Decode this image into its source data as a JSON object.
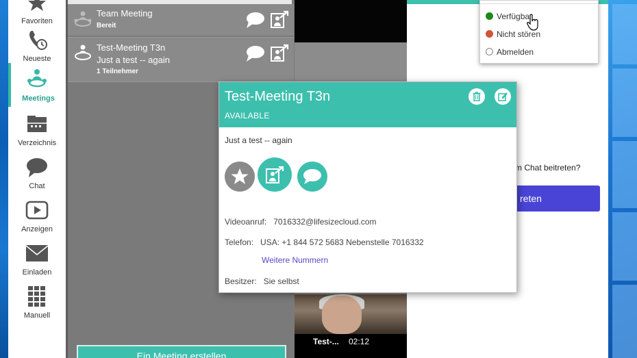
{
  "nav": {
    "items": [
      {
        "label": "Favoriten",
        "icon": "star-icon"
      },
      {
        "label": "Neueste",
        "icon": "phone-clock-icon"
      },
      {
        "label": "Meetings",
        "icon": "meeting-icon"
      },
      {
        "label": "Verzeichnis",
        "icon": "directory-icon"
      },
      {
        "label": "Chat",
        "icon": "chat-bubble-icon"
      },
      {
        "label": "Anzeigen",
        "icon": "play-icon"
      },
      {
        "label": "Einladen",
        "icon": "envelope-icon"
      },
      {
        "label": "Manuell",
        "icon": "dialpad-icon"
      }
    ],
    "active_index": 2
  },
  "meetings": [
    {
      "title": "Team Meeting",
      "status": "Bereit"
    },
    {
      "title": "Test-Meeting T3n",
      "description": "Just a test -- again",
      "participants": "1 Teilnehmer"
    }
  ],
  "create_button": "Ein Meeting erstellen",
  "video": {
    "name": "Test-...",
    "time": "02:12"
  },
  "status_menu": {
    "options": [
      {
        "label": "Verfügbar",
        "color": "#1a8a1a"
      },
      {
        "label": "Nicht stören",
        "color": "#d0533a"
      },
      {
        "label": "Abmelden",
        "color": "#ffffff"
      }
    ]
  },
  "right_panel": {
    "question": "m Chat beitreten?",
    "join_label": "reten"
  },
  "card": {
    "title": "Test-Meeting T3n",
    "status": "AVAILABLE",
    "description": "Just a test -- again",
    "video_label": "Videoanruf:",
    "video_value": "7016332@lifesizecloud.com",
    "phone_label": "Telefon:",
    "phone_value": "USA: +1 844 572 5683  Nebenstelle 7016332",
    "more_numbers": "Weitere Nummern",
    "owner_label": "Besitzer:",
    "owner_value": "Sie selbst"
  },
  "colors": {
    "accent": "#3dbfae",
    "join": "#4a44d6",
    "link": "#5a49c6"
  }
}
